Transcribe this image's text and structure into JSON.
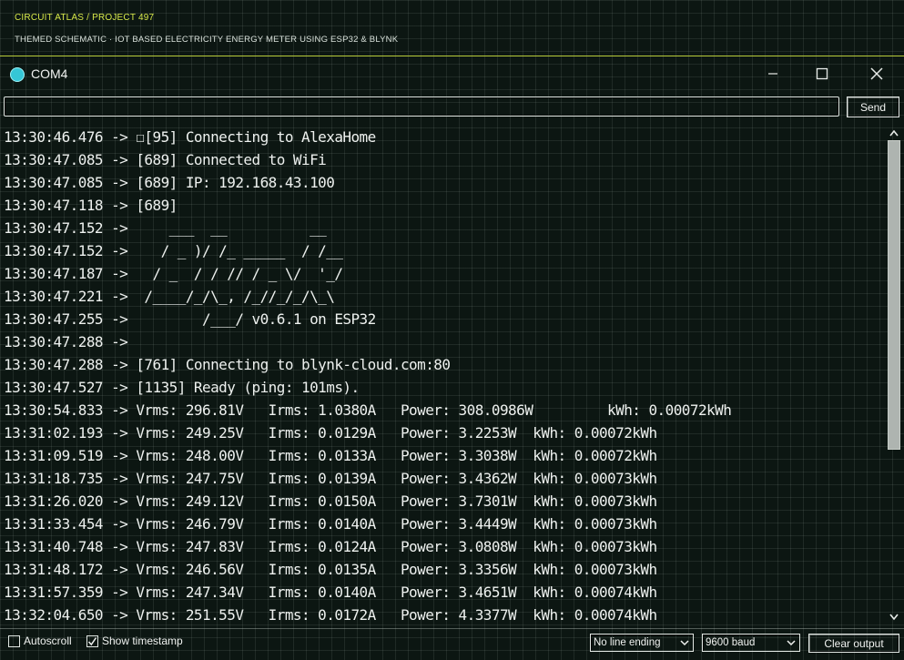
{
  "header": {
    "breadcrumb": "CIRCUIT ATLAS / PROJECT 497",
    "subtitle": "THEMED SCHEMATIC · IOT BASED ELECTRICITY ENERGY METER USING ESP32 & BLYNK"
  },
  "window": {
    "title": "COM4",
    "app_icon": "serial-monitor-icon"
  },
  "send": {
    "input_value": "",
    "button_label": "Send"
  },
  "output": {
    "lines": [
      "13:30:46.476 -> ☐[95] Connecting to AlexaHome",
      "13:30:47.085 -> [689] Connected to WiFi",
      "13:30:47.085 -> [689] IP: 192.168.43.100",
      "13:30:47.118 -> [689]",
      "13:30:47.152 ->     ___  __          __",
      "13:30:47.152 ->    / _ )/ /_ _____  / /__",
      "13:30:47.187 ->   / _  / / // / _ \\/  '_/",
      "13:30:47.221 ->  /____/_/\\_, /_//_/_/\\_\\",
      "13:30:47.255 ->         /___/ v0.6.1 on ESP32",
      "13:30:47.288 ->",
      "13:30:47.288 -> [761] Connecting to blynk-cloud.com:80",
      "13:30:47.527 -> [1135] Ready (ping: 101ms).",
      "13:30:54.833 -> Vrms: 296.81V   Irms: 1.0380A   Power: 308.0986W         kWh: 0.00072kWh",
      "13:31:02.193 -> Vrms: 249.25V   Irms: 0.0129A   Power: 3.2253W  kWh: 0.00072kWh",
      "13:31:09.519 -> Vrms: 248.00V   Irms: 0.0133A   Power: 3.3038W  kWh: 0.00072kWh",
      "13:31:18.735 -> Vrms: 247.75V   Irms: 0.0139A   Power: 3.4362W  kWh: 0.00073kWh",
      "13:31:26.020 -> Vrms: 249.12V   Irms: 0.0150A   Power: 3.7301W  kWh: 0.00073kWh",
      "13:31:33.454 -> Vrms: 246.79V   Irms: 0.0140A   Power: 3.4449W  kWh: 0.00073kWh",
      "13:31:40.748 -> Vrms: 247.83V   Irms: 0.0124A   Power: 3.0808W  kWh: 0.00073kWh",
      "13:31:48.172 -> Vrms: 246.56V   Irms: 0.0135A   Power: 3.3356W  kWh: 0.00073kWh",
      "13:31:57.359 -> Vrms: 247.34V   Irms: 0.0140A   Power: 3.4651W  kWh: 0.00074kWh",
      "13:32:04.650 -> Vrms: 251.55V   Irms: 0.0172A   Power: 4.3377W  kWh: 0.00074kWh"
    ]
  },
  "statusbar": {
    "autoscroll_label": "Autoscroll",
    "autoscroll_checked": false,
    "timestamp_label": "Show timestamp",
    "timestamp_checked": true,
    "line_ending": "No line ending",
    "baud": "9600 baud",
    "clear_label": "Clear output"
  },
  "colors": {
    "background": "#0c1612",
    "accent": "#d7e84a",
    "icon": "#35c6d6"
  }
}
